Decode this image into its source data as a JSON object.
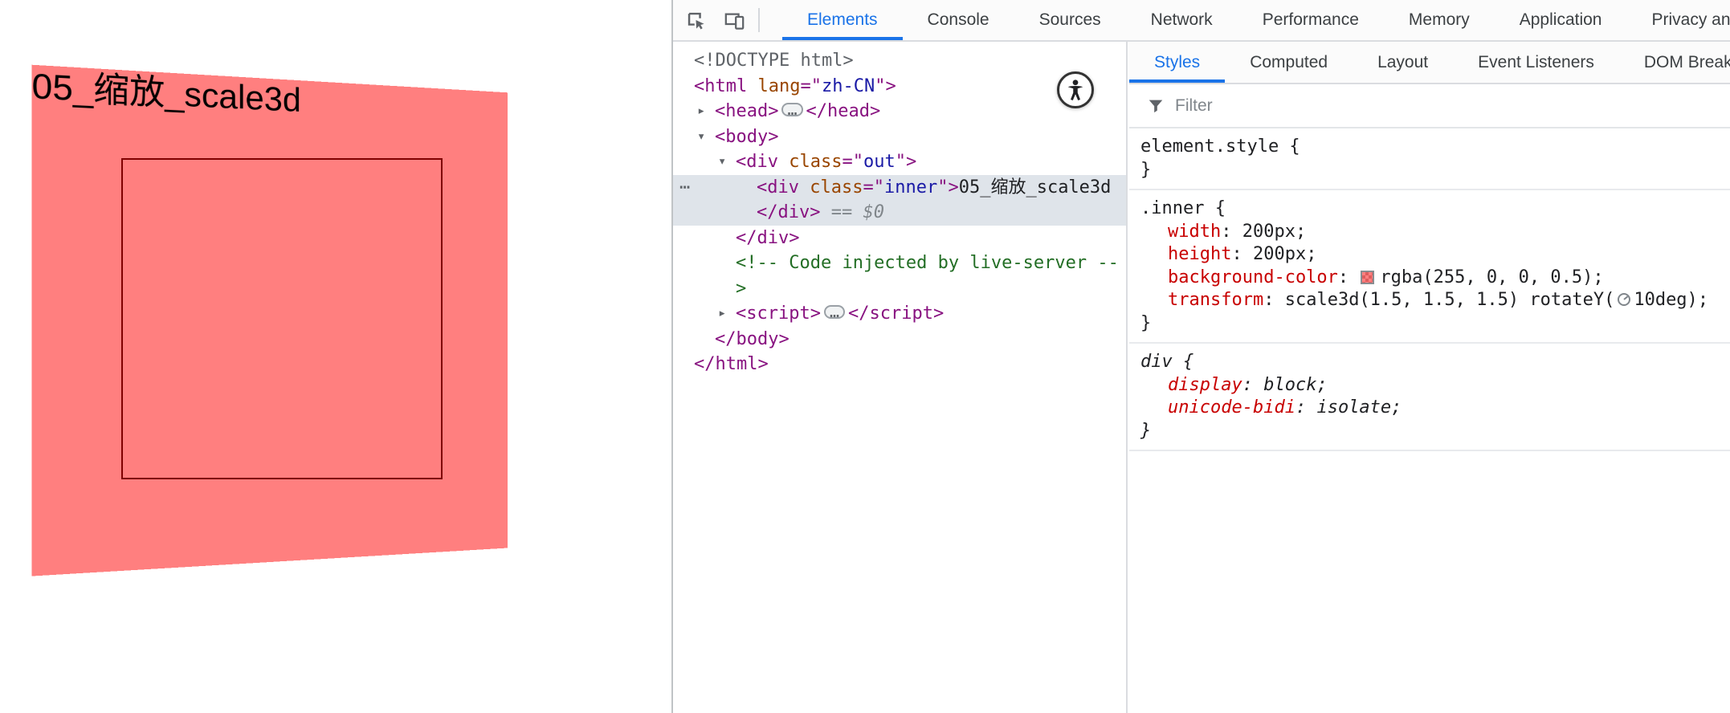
{
  "page": {
    "box_label": "05_缩放_scale3d"
  },
  "colors": {
    "accent_blue": "#1a73e8",
    "inner_background": "rgba(255, 0, 0, 0.5)",
    "selection_background": "#dfe4ea"
  },
  "devtools": {
    "main_tabs": [
      {
        "label": "Elements",
        "active": true
      },
      {
        "label": "Console"
      },
      {
        "label": "Sources"
      },
      {
        "label": "Network"
      },
      {
        "label": "Performance"
      },
      {
        "label": "Memory"
      },
      {
        "label": "Application"
      },
      {
        "label": "Privacy and security"
      }
    ],
    "elements_tree": {
      "lines": [
        {
          "indent": 0,
          "segments": [
            [
              "d",
              "<!DOCTYPE html>"
            ]
          ]
        },
        {
          "indent": 0,
          "segments": [
            [
              "p",
              "<"
            ],
            [
              "t",
              "html"
            ],
            [
              "a",
              " lang"
            ],
            [
              "p",
              "=\""
            ],
            [
              "v",
              "zh-CN"
            ],
            [
              "p",
              "\">"
            ]
          ]
        },
        {
          "indent": 1,
          "arrow": "collapsed",
          "segments": [
            [
              "p",
              "<"
            ],
            [
              "t",
              "head"
            ],
            [
              "p",
              ">"
            ],
            [
              "e",
              "…"
            ],
            [
              "p",
              "</"
            ],
            [
              "t",
              "head"
            ],
            [
              "p",
              ">"
            ]
          ]
        },
        {
          "indent": 1,
          "arrow": "expanded",
          "segments": [
            [
              "p",
              "<"
            ],
            [
              "t",
              "body"
            ],
            [
              "p",
              ">"
            ]
          ]
        },
        {
          "indent": 2,
          "arrow": "expanded",
          "segments": [
            [
              "p",
              "<"
            ],
            [
              "t",
              "div"
            ],
            [
              "a",
              " class"
            ],
            [
              "p",
              "=\""
            ],
            [
              "v",
              "out"
            ],
            [
              "p",
              "\">"
            ]
          ]
        },
        {
          "indent": 3,
          "selected": true,
          "dots": true,
          "segments": [
            [
              "p",
              "<"
            ],
            [
              "t",
              "div"
            ],
            [
              "a",
              " class"
            ],
            [
              "p",
              "=\""
            ],
            [
              "v",
              "inner"
            ],
            [
              "p",
              "\">"
            ],
            [
              "x",
              "05_缩放_scale3d"
            ]
          ]
        },
        {
          "indent": 3,
          "selected": true,
          "segments": [
            [
              "p",
              "</"
            ],
            [
              "t",
              "div"
            ],
            [
              "p",
              ">"
            ],
            [
              "i",
              " == $0"
            ]
          ]
        },
        {
          "indent": 2,
          "segments": [
            [
              "p",
              "</"
            ],
            [
              "t",
              "div"
            ],
            [
              "p",
              ">"
            ]
          ]
        },
        {
          "indent": 2,
          "segments": [
            [
              "c",
              "<!-- Code injected by live-server --"
            ]
          ]
        },
        {
          "indent": 2,
          "segments": [
            [
              "c",
              ">"
            ]
          ]
        },
        {
          "indent": 2,
          "arrow": "collapsed",
          "segments": [
            [
              "p",
              "<"
            ],
            [
              "t",
              "script"
            ],
            [
              "p",
              ">"
            ],
            [
              "e",
              "…"
            ],
            [
              "p",
              "</"
            ],
            [
              "t",
              "script"
            ],
            [
              "p",
              ">"
            ]
          ]
        },
        {
          "indent": 1,
          "segments": [
            [
              "p",
              "</"
            ],
            [
              "t",
              "body"
            ],
            [
              "p",
              ">"
            ]
          ]
        },
        {
          "indent": 0,
          "segments": [
            [
              "p",
              "</"
            ],
            [
              "t",
              "html"
            ],
            [
              "p",
              ">"
            ]
          ]
        }
      ]
    },
    "styles_sidebar": {
      "tabs": [
        {
          "label": "Styles",
          "active": true
        },
        {
          "label": "Computed"
        },
        {
          "label": "Layout"
        },
        {
          "label": "Event Listeners"
        },
        {
          "label": "DOM Breakpoints"
        }
      ],
      "filter_placeholder": "Filter",
      "rules": [
        {
          "selector": "element.style",
          "properties": []
        },
        {
          "selector": ".inner",
          "properties": [
            {
              "name": "width",
              "segments": [
                {
                  "type": "text",
                  "text": "200px"
                }
              ]
            },
            {
              "name": "height",
              "segments": [
                {
                  "type": "text",
                  "text": "200px"
                }
              ]
            },
            {
              "name": "background-color",
              "segments": [
                {
                  "type": "swatch"
                },
                {
                  "type": "text",
                  "text": "rgba(255, 0, 0, 0.5)"
                }
              ]
            },
            {
              "name": "transform",
              "segments": [
                {
                  "type": "text",
                  "text": "scale3d(1.5, 1.5, 1.5) rotateY("
                },
                {
                  "type": "angle-icon"
                },
                {
                  "type": "text",
                  "text": "10deg)"
                }
              ]
            }
          ]
        },
        {
          "selector": "div",
          "user_agent": true,
          "properties": [
            {
              "name": "display",
              "segments": [
                {
                  "type": "text",
                  "text": "block"
                }
              ]
            },
            {
              "name": "unicode-bidi",
              "segments": [
                {
                  "type": "text",
                  "text": "isolate"
                }
              ]
            }
          ]
        }
      ]
    }
  }
}
